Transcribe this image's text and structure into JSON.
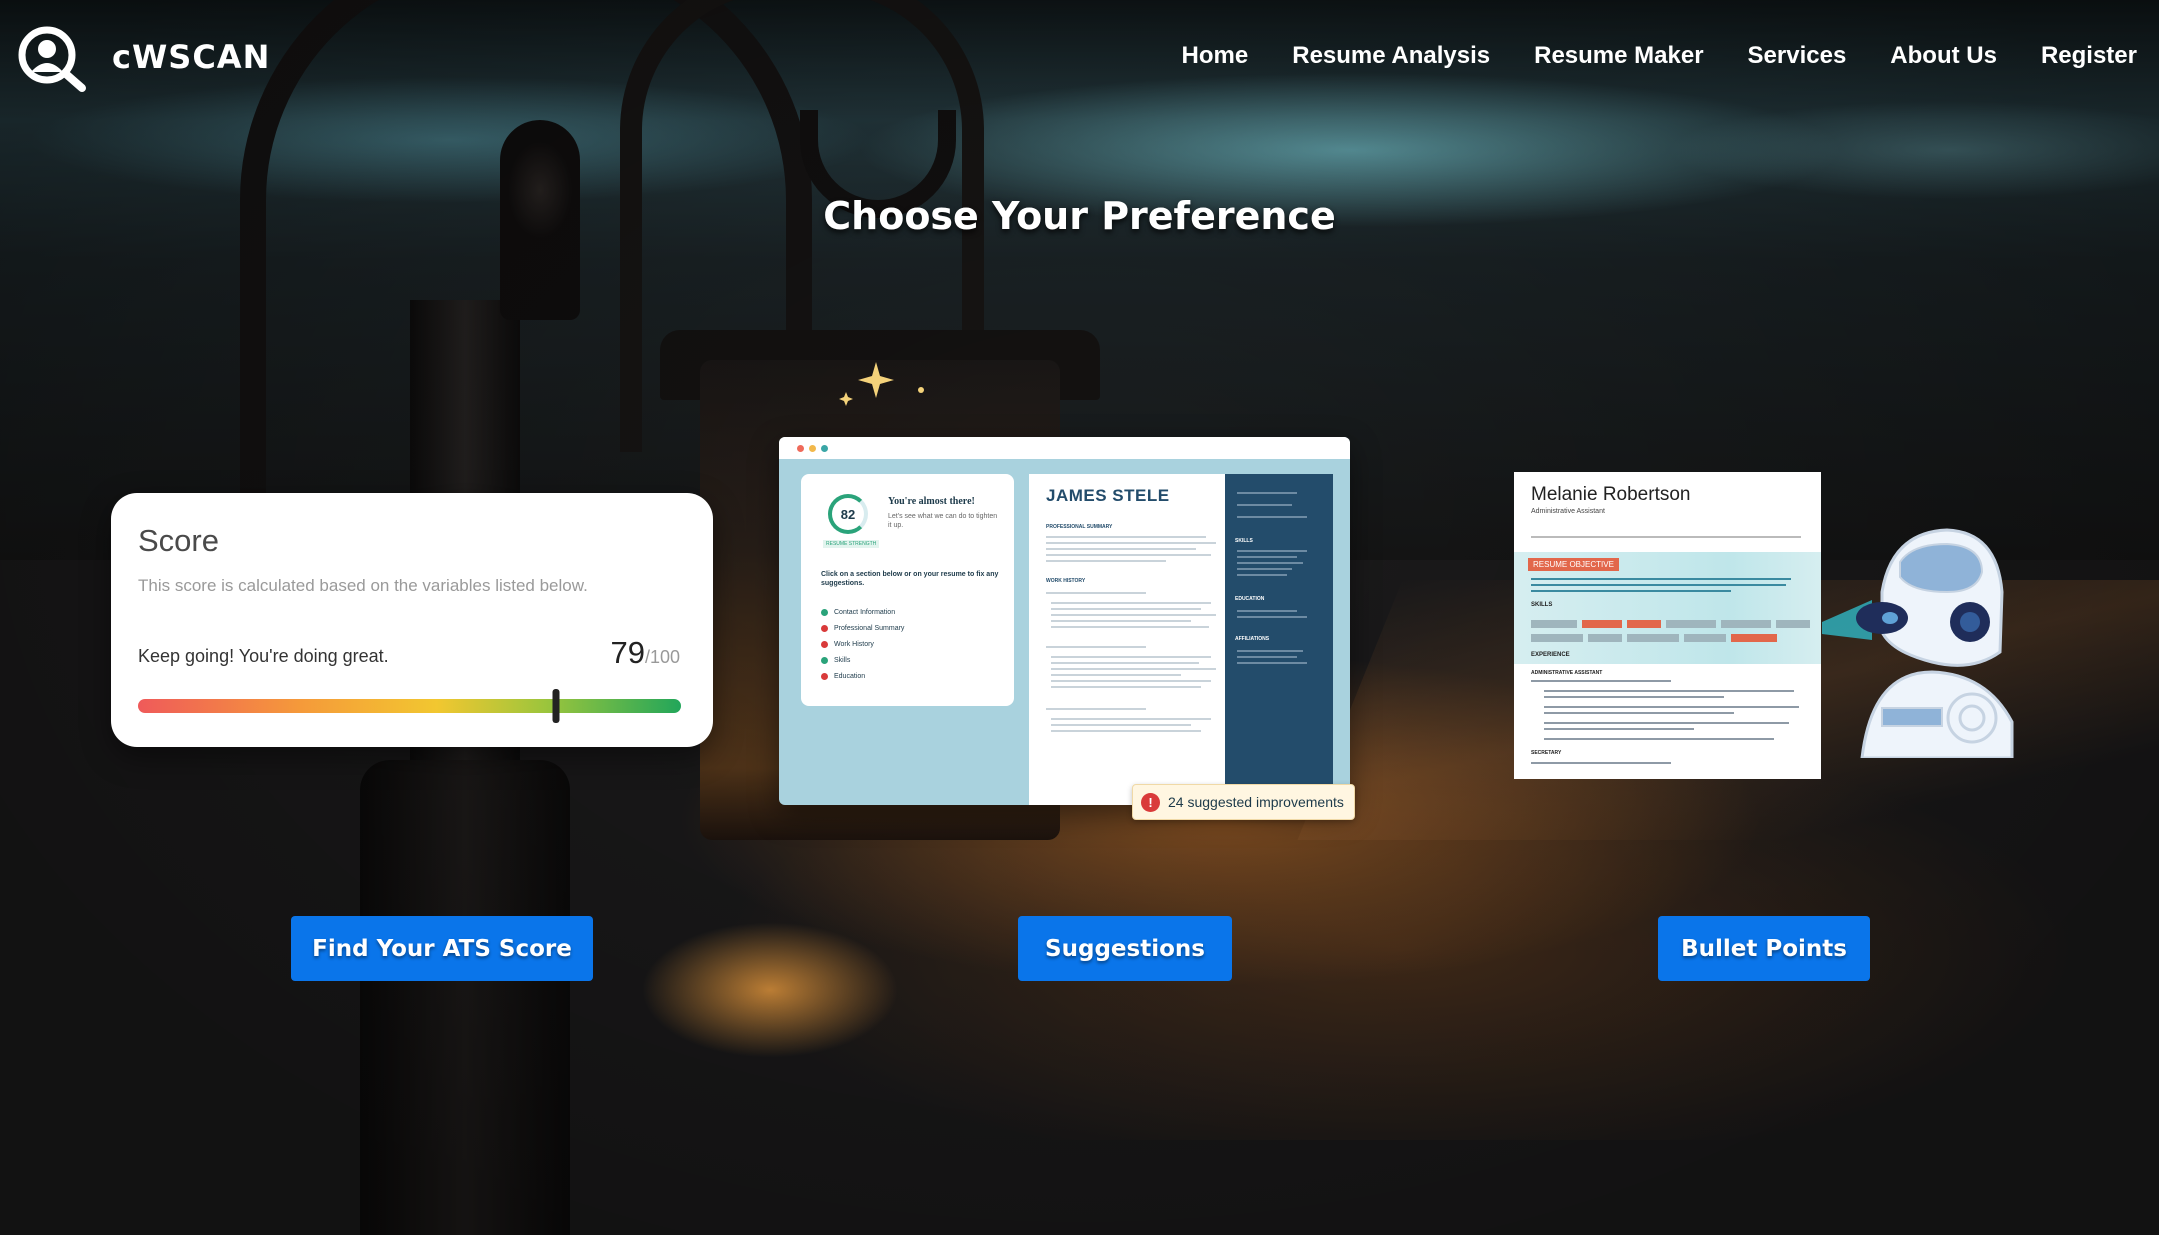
{
  "header": {
    "brand": "cWSCAN",
    "nav": [
      "Home",
      "Resume Analysis",
      "Resume Maker",
      "Services",
      "About Us",
      "Register"
    ]
  },
  "page": {
    "title": "Choose Your Preference"
  },
  "score_card": {
    "title": "Score",
    "description": "This score is calculated based on the variables listed below.",
    "message": "Keep going! You're doing great.",
    "score": "79",
    "out_of": "/100",
    "score_fraction": 0.77
  },
  "suggestions_card": {
    "ring_score": "82",
    "headline": "You're almost there!",
    "subtext": "Let's see what we can do to tighten it up.",
    "badge": "RESUME STRENGTH",
    "instruction": "Click on a section below or on your resume to fix any suggestions.",
    "sections": [
      {
        "label": "Contact Information",
        "status": "ok"
      },
      {
        "label": "Professional Summary",
        "status": "issue"
      },
      {
        "label": "Work History",
        "status": "issue"
      },
      {
        "label": "Skills",
        "status": "ok"
      },
      {
        "label": "Education",
        "status": "issue"
      }
    ],
    "resume_name": "JAMES STELE",
    "resume_sections": [
      "PROFESSIONAL SUMMARY",
      "WORK HISTORY"
    ],
    "side_sections": [
      "SKILLS",
      "EDUCATION",
      "AFFILIATIONS"
    ],
    "improvements": "24 suggested improvements"
  },
  "bullet_card": {
    "name": "Melanie Robertson",
    "role": "Administrative Assistant",
    "section_tag": "RESUME OBJECTIVE",
    "sections": [
      "SKILLS",
      "EXPERIENCE",
      "ADMINISTRATIVE ASSISTANT",
      "SECRETARY"
    ]
  },
  "buttons": {
    "ats": "Find Your ATS Score",
    "suggestions": "Suggestions",
    "bullets": "Bullet Points"
  },
  "colors": {
    "button": "#0a75ea",
    "ok": "#2aa37a",
    "issue": "#d93a3a",
    "resume_navy": "#234c6b"
  },
  "icons": [
    "logo-magnifier-person-icon",
    "sparkle-icon",
    "warning-icon",
    "robot-illustration"
  ]
}
